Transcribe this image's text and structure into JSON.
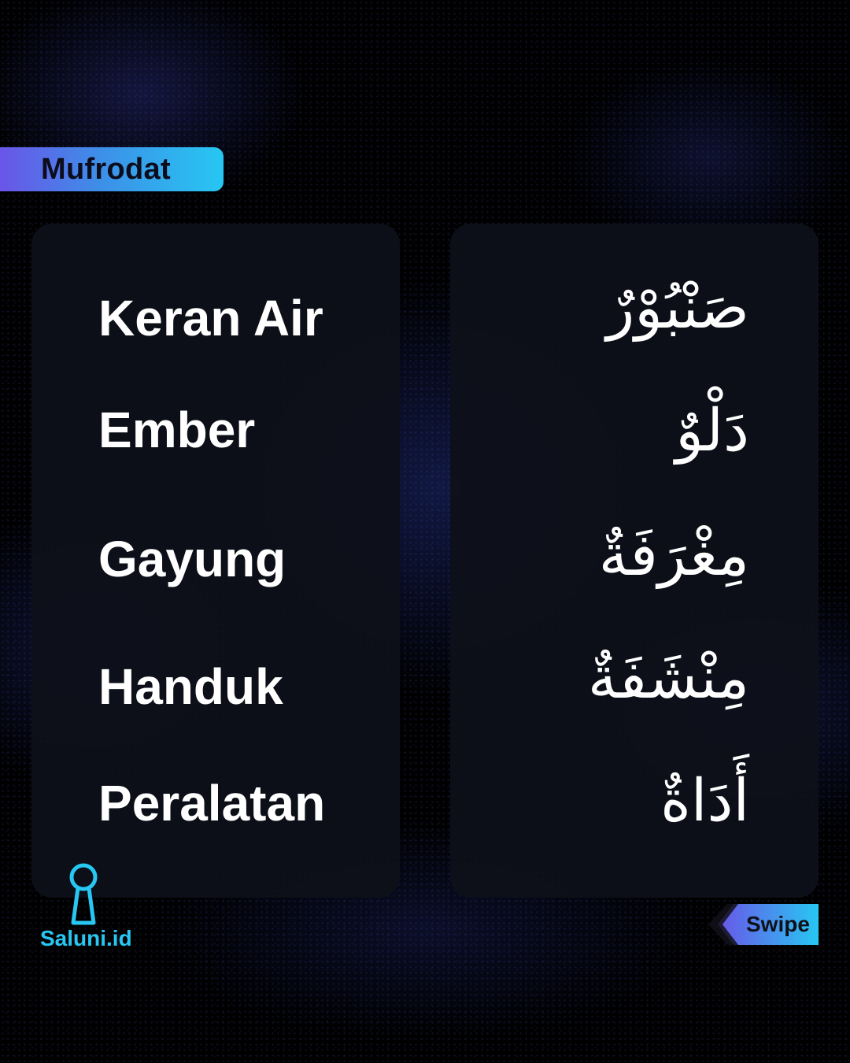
{
  "tag": {
    "label": "Mufrodat"
  },
  "vocabulary": [
    {
      "indonesian": "Keran Air",
      "arabic": "صَنْبُوْرٌ"
    },
    {
      "indonesian": "Ember",
      "arabic": "دَلْوٌ"
    },
    {
      "indonesian": "Gayung",
      "arabic": "مِغْرَفَةٌ"
    },
    {
      "indonesian": "Handuk",
      "arabic": "مِنْشَفَةٌ"
    },
    {
      "indonesian": "Peralatan",
      "arabic": "أَدَاةٌ"
    }
  ],
  "brand": {
    "name": "Saluni.id",
    "icon": "keyhole-icon"
  },
  "swipe": {
    "label": "Swipe",
    "icon": "chevron-left-icon"
  },
  "colors": {
    "accent_cyan": "#27c7f2",
    "accent_purple": "#6a55e8",
    "card_bg": "#0e101a",
    "text": "#ffffff"
  }
}
